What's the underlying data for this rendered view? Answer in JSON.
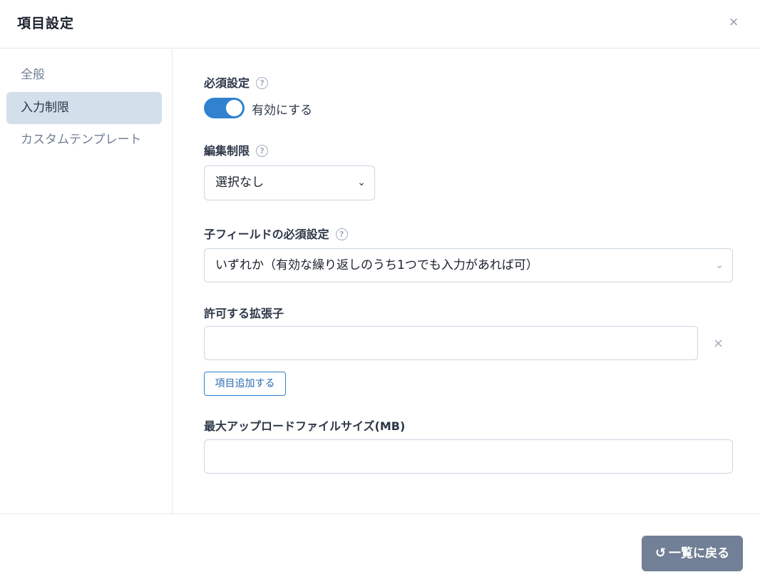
{
  "dialog": {
    "title": "項目設定",
    "close_icon": "×"
  },
  "sidebar": {
    "items": [
      {
        "label": "全般",
        "active": false
      },
      {
        "label": "入力制限",
        "active": true
      },
      {
        "label": "カスタムテンプレート",
        "active": false
      }
    ]
  },
  "form": {
    "required": {
      "label": "必須設定",
      "toggle_on": true,
      "toggle_text": "有効にする"
    },
    "edit_restriction": {
      "label": "編集制限",
      "selected": "選択なし"
    },
    "child_required": {
      "label": "子フィールドの必須設定",
      "selected": "いずれか（有効な繰り返しのうち1つでも入力があれば可）"
    },
    "extensions": {
      "label": "許可する拡張子",
      "value": "",
      "remove_icon": "×",
      "add_label": "項目追加する"
    },
    "max_upload": {
      "label": "最大アップロードファイルサイズ(MB)",
      "value": ""
    }
  },
  "help_icon": "?",
  "chevron_icon": "⌄",
  "footer": {
    "back_label": "一覧に戻る",
    "back_icon": "↺"
  },
  "colors": {
    "accent": "#3182ce",
    "active_bg": "#d3dfeb",
    "button_bg": "#718096"
  }
}
